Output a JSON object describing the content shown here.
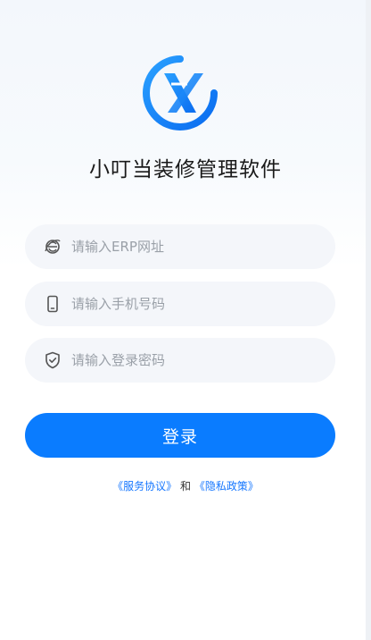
{
  "app": {
    "name": "小叮当装修管理软件"
  },
  "form": {
    "erp_url": {
      "placeholder": "请输入ERP网址",
      "value": ""
    },
    "phone": {
      "placeholder": "请输入手机号码",
      "value": ""
    },
    "password": {
      "placeholder": "请输入登录密码",
      "value": ""
    }
  },
  "login_button": {
    "label": "登录"
  },
  "agreement": {
    "service_link": "《服务协议》",
    "conjunction": "和",
    "privacy_link": "《隐私政策》"
  },
  "colors": {
    "accent": "#0a7cff",
    "link": "#1677ff",
    "field_bg": "#f4f6fa"
  },
  "icons": [
    "logo-x-icon",
    "browser-e-icon",
    "phone-icon",
    "shield-check-icon"
  ]
}
